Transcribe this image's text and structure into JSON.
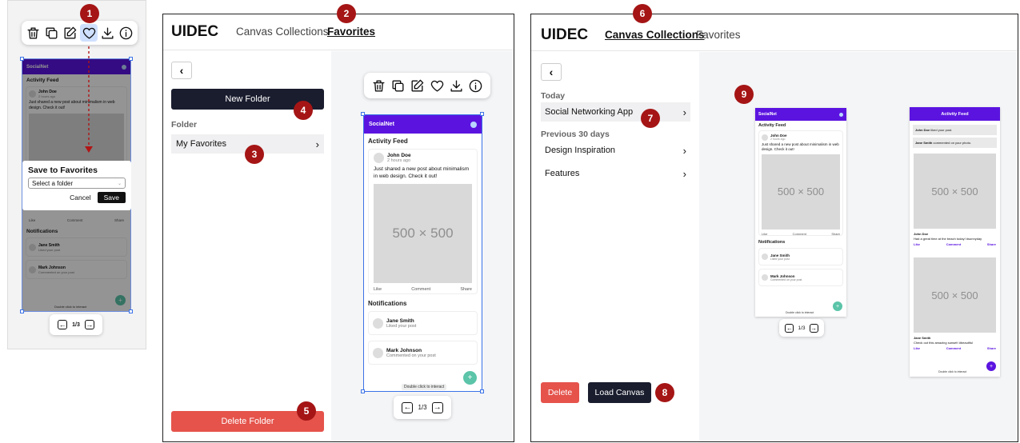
{
  "toolbar_icons": [
    "trash-icon",
    "copy-icon",
    "edit-icon",
    "heart-icon",
    "download-icon",
    "info-icon"
  ],
  "badges": {
    "b1": "1",
    "b2": "2",
    "b3": "3",
    "b4": "4",
    "b5": "5",
    "b6": "6",
    "b7": "7",
    "b8": "8",
    "b9": "9"
  },
  "phone": {
    "brand": "SocialNet",
    "section_feed": "Activity Feed",
    "post_author": "John Doe",
    "post_time": "2 hours ago",
    "post_text": "Just shared a new post about minimalism in web design. Check it out!",
    "image_label": "500 × 500",
    "like": "Like",
    "comment": "Comment",
    "share": "Share",
    "section_notif": "Notifications",
    "notif1_name": "Jane Smith",
    "notif1_text": "Liked your post",
    "notif2_name": "Mark Johnson",
    "notif2_text": "Commented on your post",
    "fab": "+",
    "hint": "Double click to interact"
  },
  "pager": {
    "label": "1/3"
  },
  "dialog": {
    "title": "Save to Favorites",
    "placeholder": "Select a folder",
    "cancel": "Cancel",
    "save": "Save"
  },
  "panel2": {
    "app_title": "UIDEC",
    "tab_canvas": "Canvas Collections",
    "tab_favorites": "Favorites",
    "back": "‹",
    "new_folder": "New Folder",
    "folder_label": "Folder",
    "folder_item": "My Favorites",
    "chevron": "›",
    "delete_folder": "Delete Folder"
  },
  "panel3": {
    "app_title": "UIDEC",
    "tab_canvas": "Canvas Collections",
    "tab_favorites": "Favorites",
    "back": "‹",
    "group_today": "Today",
    "item1": "Social Networking App",
    "group_prev": "Previous 30 days",
    "item2": "Design Inspiration",
    "item3": "Features",
    "chevron": "›",
    "delete": "Delete",
    "load": "Load Canvas"
  },
  "feed2": {
    "title": "Activity Feed",
    "n1_name": "John Doe",
    "n1_text": "liked your post.",
    "n2_name": "Jane Smith",
    "n2_text": "commented on your photo.",
    "img": "500 × 500",
    "p1_author": "John Doe",
    "p1_text": "Had a great time at the beach today! #sunnyday",
    "p2_author": "Jane Smith",
    "p2_text": "Check out this amazing sunset! #beautiful",
    "like": "Like",
    "comment": "Comment",
    "share": "Share",
    "hint": "Double click to interact",
    "fab": "+"
  },
  "colors": {
    "brand": "#5b14e0",
    "dark": "#1a1d2e",
    "danger": "#e5534b",
    "badge": "#a51515",
    "teal": "#5bc4a9"
  }
}
